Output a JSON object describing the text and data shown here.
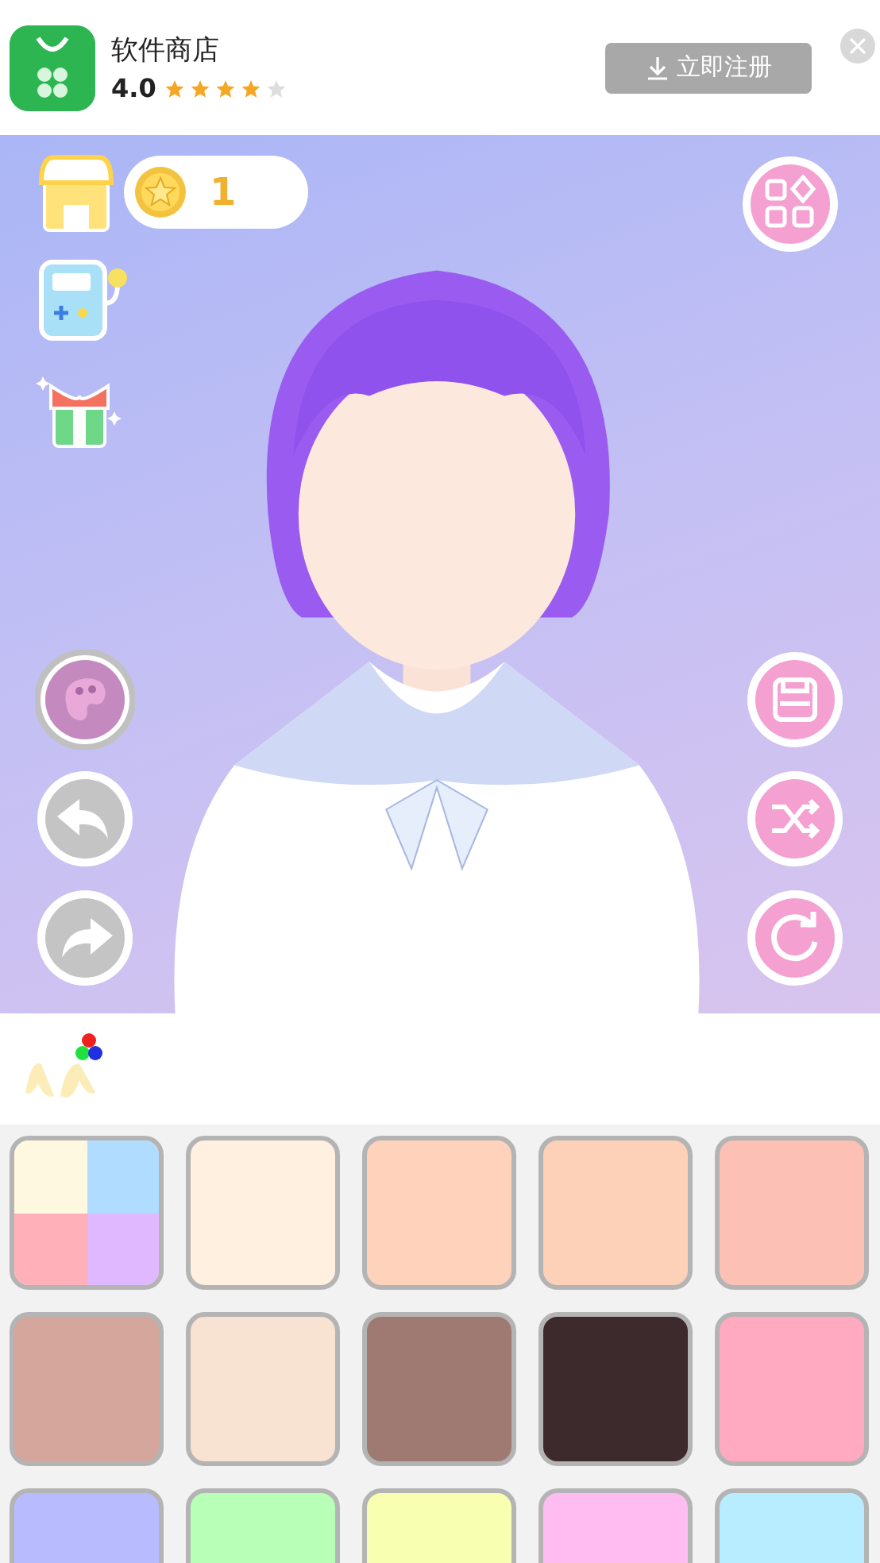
{
  "ad_banner": {
    "app_name": "软件商店",
    "rating": "4.0",
    "stars": 4,
    "button": "立即注册"
  },
  "scene": {
    "coins": "1"
  },
  "swatches": [
    {
      "kind": "multi",
      "parts": [
        {
          "color": "#fff8e0"
        },
        {
          "color": "#b0dcff"
        },
        {
          "color": "#ffb0b8"
        },
        {
          "color": "#e0b8ff"
        }
      ]
    },
    {
      "kind": "solid",
      "color": "#fff0e0"
    },
    {
      "kind": "solid",
      "color": "#ffd2bc"
    },
    {
      "kind": "solid",
      "color": "#fdd0b8"
    },
    {
      "kind": "solid",
      "color": "#fcc0b4"
    },
    {
      "kind": "solid",
      "color": "#d4a69c"
    },
    {
      "kind": "solid",
      "color": "#f8e2d2"
    },
    {
      "kind": "solid",
      "color": "#9e7a72"
    },
    {
      "kind": "solid",
      "color": "#3c2a2c"
    },
    {
      "kind": "solid",
      "color": "#ffaac0"
    },
    {
      "kind": "solid",
      "color": "#b8bcff"
    },
    {
      "kind": "solid",
      "color": "#b8ffb8"
    },
    {
      "kind": "solid",
      "color": "#f8ffb0"
    },
    {
      "kind": "solid",
      "color": "#ffbcf0"
    },
    {
      "kind": "solid",
      "color": "#b8ecff"
    }
  ]
}
